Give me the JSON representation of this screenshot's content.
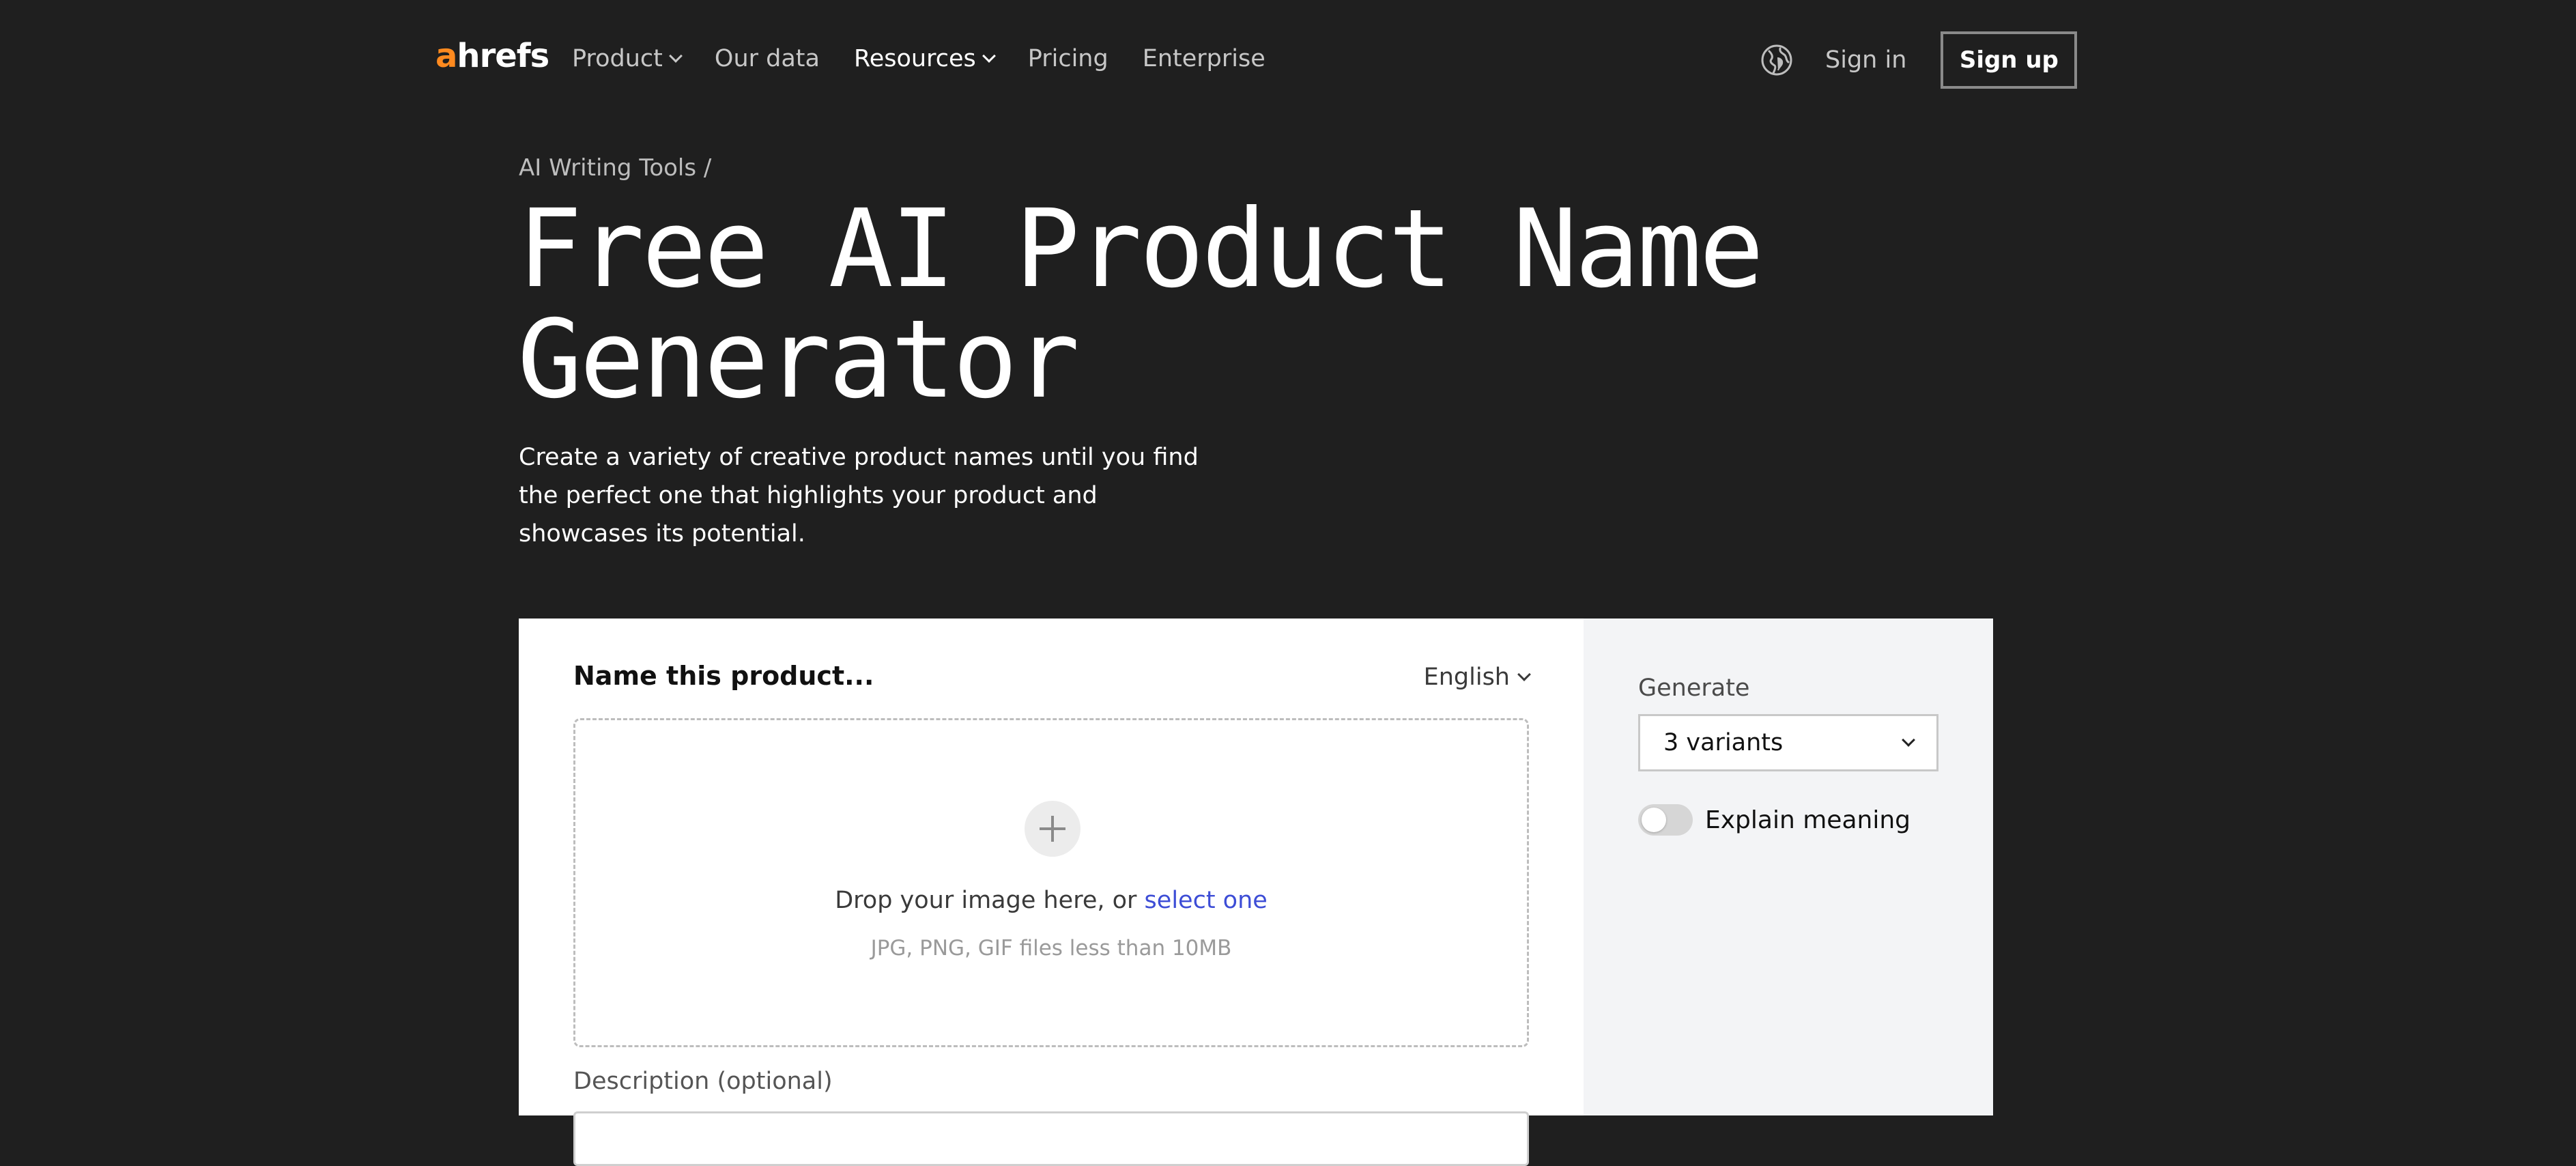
{
  "colors": {
    "page_bg": "#1f1f1f",
    "brand_accent": "#ff8a1f",
    "link_blue": "#3d4dd6",
    "card_bg": "#ffffff",
    "side_panel_bg": "#f3f4f6"
  },
  "header": {
    "logo_first": "a",
    "logo_rest": "hrefs",
    "nav": [
      {
        "label": "Product",
        "has_dropdown": true
      },
      {
        "label": "Our data",
        "has_dropdown": false
      },
      {
        "label": "Resources",
        "has_dropdown": true
      },
      {
        "label": "Pricing",
        "has_dropdown": false
      },
      {
        "label": "Enterprise",
        "has_dropdown": false
      }
    ],
    "language_icon": "globe-icon",
    "sign_in": "Sign in",
    "sign_up": "Sign up"
  },
  "hero": {
    "breadcrumb": "AI Writing Tools /",
    "title_line1": "Free AI Product Name",
    "title_line2": "Generator",
    "description": "Create a variety of creative product names until you find the perfect one that highlights your product and showcases its potential."
  },
  "tool": {
    "field_title": "Name this product...",
    "language": "English",
    "dropzone": {
      "icon": "plus-icon",
      "text_before": "Drop your image here, or ",
      "link": "select one",
      "hint": "JPG, PNG, GIF files less than 10MB"
    },
    "description_label": "Description (optional)",
    "generate": {
      "label": "Generate",
      "selected": "3 variants"
    },
    "explain_toggle": {
      "label": "Explain meaning",
      "on": false
    }
  }
}
